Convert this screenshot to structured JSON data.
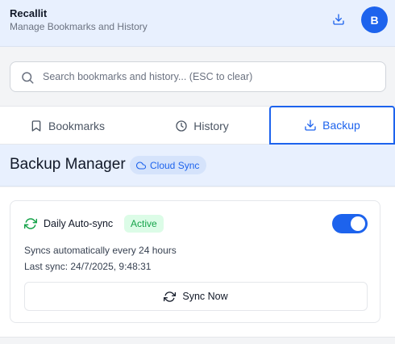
{
  "header": {
    "title": "Recallit",
    "subtitle": "Manage Bookmarks and History",
    "avatar_letter": "B"
  },
  "search": {
    "placeholder": "Search bookmarks and history... (ESC to clear)",
    "value": ""
  },
  "tabs": [
    {
      "label": "Bookmarks",
      "icon": "bookmark-icon",
      "active": false
    },
    {
      "label": "History",
      "icon": "clock-icon",
      "active": false
    },
    {
      "label": "Backup",
      "icon": "download-icon",
      "active": true
    }
  ],
  "section": {
    "title": "Backup Manager",
    "badge": "Cloud Sync"
  },
  "auto_sync": {
    "title": "Daily Auto-sync",
    "status": "Active",
    "enabled": true,
    "description": "Syncs automatically every 24 hours",
    "last_sync": "Last sync: 24/7/2025, 9:48:31",
    "button_label": "Sync Now"
  },
  "colors": {
    "accent": "#1d63ed",
    "header_bg": "#e8f0fe",
    "success": "#16a34a",
    "success_bg": "#dcfce7"
  }
}
